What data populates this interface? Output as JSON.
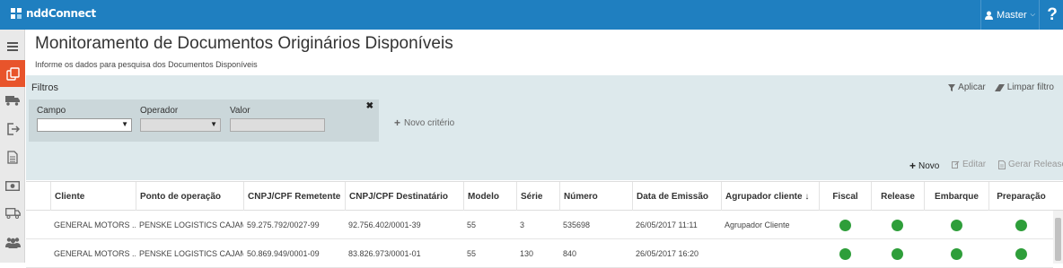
{
  "app": {
    "brand": "nddConnect",
    "user": "Master",
    "help": "?"
  },
  "page": {
    "title": "Monitoramento de Documentos Originários Disponíveis",
    "subtitle": "Informe os dados para pesquisa dos Documentos Disponíveis"
  },
  "filters": {
    "label": "Filtros",
    "apply": "Aplicar",
    "clear": "Limpar filtro",
    "campo_label": "Campo",
    "operador_label": "Operador",
    "valor_label": "Valor",
    "campo_value": "",
    "operador_value": "",
    "valor_value": "",
    "new_criterion": "Novo critério"
  },
  "toolbar": {
    "new": "Novo",
    "edit": "Editar",
    "release": "Gerar Release"
  },
  "table": {
    "columns": [
      "Cliente",
      "Ponto de operação",
      "CNPJ/CPF Remetente",
      "CNPJ/CPF Destinatário",
      "Modelo",
      "Série",
      "Número",
      "Data de Emissão",
      "Agrupador cliente ↓",
      "Fiscal",
      "Release",
      "Embarque",
      "Preparação"
    ],
    "rows": [
      {
        "cliente": "GENERAL MOTORS ...",
        "ponto": "PENSKE LOGISTICS CAJAM...",
        "remetente": "59.275.792/0027-99",
        "destinatario": "92.756.402/0001-39",
        "modelo": "55",
        "serie": "3",
        "numero": "535698",
        "data": "26/05/2017 11:11",
        "agrupador": "Agrupador Cliente"
      },
      {
        "cliente": "GENERAL MOTORS ...",
        "ponto": "PENSKE LOGISTICS CAJAM...",
        "remetente": "50.869.949/0001-09",
        "destinatario": "83.826.973/0001-01",
        "modelo": "55",
        "serie": "130",
        "numero": "840",
        "data": "26/05/2017 16:20",
        "agrupador": ""
      }
    ],
    "status_color": "#2e9e3a"
  },
  "colors": {
    "topbar": "#1f7fc0",
    "active_nav": "#e8542b",
    "filter_bg": "#dde9ec"
  },
  "sidebar_icons": [
    "menu-icon",
    "documents-icon",
    "truck-icon",
    "exit-icon",
    "file-icon",
    "money-icon",
    "delivery-truck-icon",
    "users-icon"
  ]
}
